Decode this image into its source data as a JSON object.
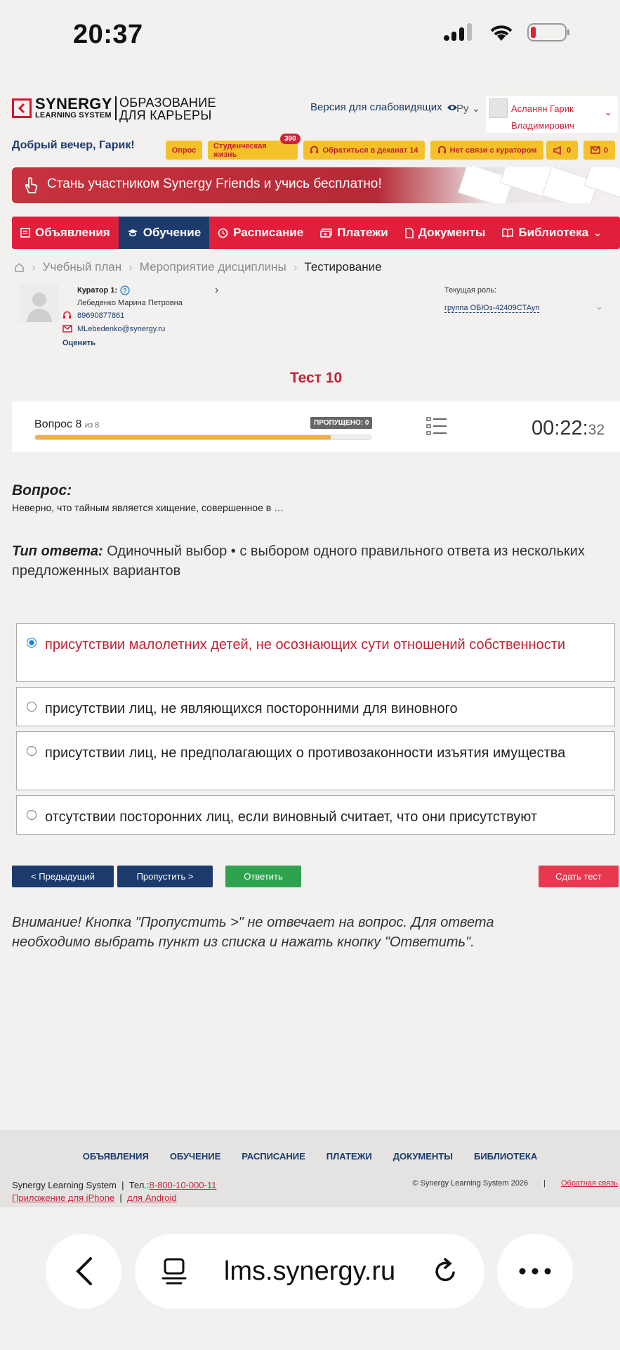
{
  "status_bar": {
    "time": "20:37"
  },
  "header": {
    "logo": {
      "brand": "SYNERGY",
      "sub": "LEARNING SYSTEM",
      "tagline_1": "ОБРАЗОВАНИЕ",
      "tagline_2": "ДЛЯ КАРЬЕРЫ"
    },
    "hearing_version": "Версия для слабовидящих",
    "language": "Ру",
    "user_name_1": "Асланян Гарик",
    "user_name_2": "Владимирович",
    "greeting": "Добрый вечер, Гарик!"
  },
  "chips": {
    "survey": "Опрос",
    "student_life": "Студенческая жизнь",
    "student_life_badge": "390",
    "deanery": "Обратиться в деканат 14",
    "curator": "Нет связи с куратором",
    "announcements_count": "0",
    "messages_count": "0"
  },
  "banner": {
    "text": "Стань участником Synergy Friends и учись бесплатно!"
  },
  "nav": {
    "items": [
      {
        "label": "Объявления"
      },
      {
        "label": "Обучение"
      },
      {
        "label": "Расписание"
      },
      {
        "label": "Платежи"
      },
      {
        "label": "Документы"
      },
      {
        "label": "Библиотека"
      }
    ]
  },
  "breadcrumb": {
    "items": [
      "Учебный план",
      "Мероприятие дисциплины",
      "Тестирование"
    ]
  },
  "curator": {
    "label": "Куратор 1:",
    "name": "Лебеденко Марина Петровна",
    "phone": "89690877861",
    "email": "MLebedenko@synergy.ru",
    "rate": "Оценить"
  },
  "role": {
    "label": "Текущая роль:",
    "value": "группа ОБЮз-42409СТАуп"
  },
  "test": {
    "title": "Тест 10",
    "question_label": "Вопрос 8",
    "question_of": "из 8",
    "skipped": "ПРОПУЩЕНО: 0",
    "progress_fraction": 0.88,
    "timer_main": "00:22:",
    "timer_sec": "32",
    "question_heading": "Вопрос:",
    "question_text": "Неверно, что тайным является хищение, совершенное в …",
    "answer_type_label": "Тип ответа:",
    "answer_type_text": "Одиночный выбор • с выбором одного правильного ответа из нескольких предложенных вариантов",
    "options": [
      {
        "text": "присутствии малолетних детей, не осознающих сути отношений собственности",
        "selected": true
      },
      {
        "text": "присутствии лиц, не являющихся посторонними для виновного",
        "selected": false
      },
      {
        "text": "присутствии лиц, не предполагающих о противозаконности изъятия имущества",
        "selected": false
      },
      {
        "text": "отсутствии посторонних лиц, если виновный считает, что они присутствуют",
        "selected": false
      }
    ],
    "btn_prev": "< Предыдущий",
    "btn_skip": "Пропустить >",
    "btn_answer": "Ответить",
    "btn_submit": "Сдать тест",
    "warning": "Внимание! Кнопка \"Пропустить >\" не отвечает на вопрос. Для ответа необходимо выбрать пункт из списка и нажать кнопку \"Ответить\"."
  },
  "footer": {
    "links": [
      "ОБЪЯВЛЕНИЯ",
      "ОБУЧЕНИЕ",
      "РАСПИСАНИЕ",
      "ПЛАТЕЖИ",
      "ДОКУМЕНТЫ",
      "БИБЛИОТЕКА"
    ],
    "company": "Synergy Learning System",
    "phone_label": "Тел.:",
    "phone": "8-800-10-000-11",
    "app_iphone": "Приложение для iPhone",
    "app_android": "для Android",
    "copyright": "© Synergy Learning System 2026",
    "feedback": "Обратная связь"
  },
  "browser": {
    "url": "lms.synergy.ru"
  },
  "colors": {
    "brand_red": "#e11f3b",
    "navy": "#1c3b6c",
    "chip_yellow": "#f5c12a",
    "answer_green": "#2ea34e",
    "submit_red": "#e8384f"
  }
}
